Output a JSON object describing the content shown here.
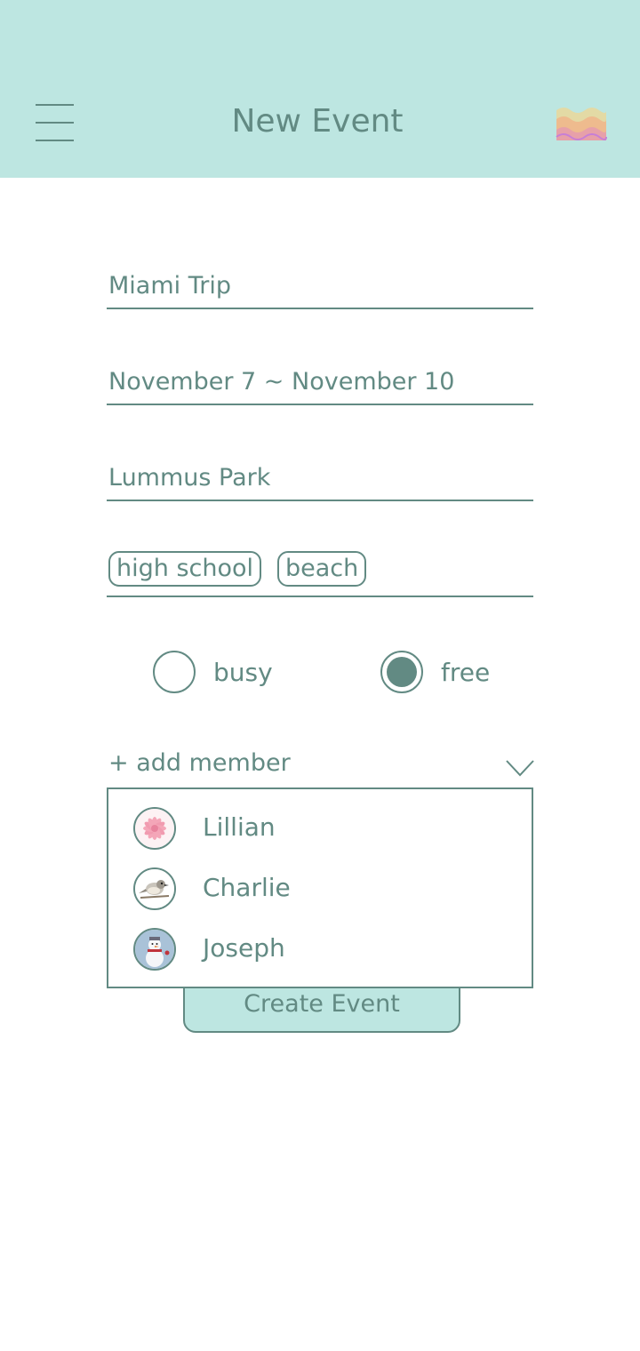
{
  "header": {
    "title": "New Event",
    "menu_icon": "hamburger-menu-icon",
    "logo_icon": "wave-logo-icon"
  },
  "form": {
    "event_name": "Miami Trip",
    "date_range": "November 7 ~ November 10",
    "location": "Lummus Park",
    "tags": [
      "high school",
      "beach"
    ],
    "status": {
      "options": [
        "busy",
        "free"
      ],
      "selected": "free"
    },
    "add_member_label": "+ add member",
    "add_member_icon": "chevron-down-icon",
    "create_button_label": "Create Event"
  },
  "members_dropdown": {
    "members": [
      {
        "name": "Lillian",
        "avatar": "pink-flower-avatar"
      },
      {
        "name": "Charlie",
        "avatar": "bird-avatar"
      },
      {
        "name": "Joseph",
        "avatar": "snowman-avatar"
      }
    ]
  },
  "colors": {
    "header_bg": "#bde6e1",
    "accent": "#628a83",
    "background": "#ffffff"
  }
}
